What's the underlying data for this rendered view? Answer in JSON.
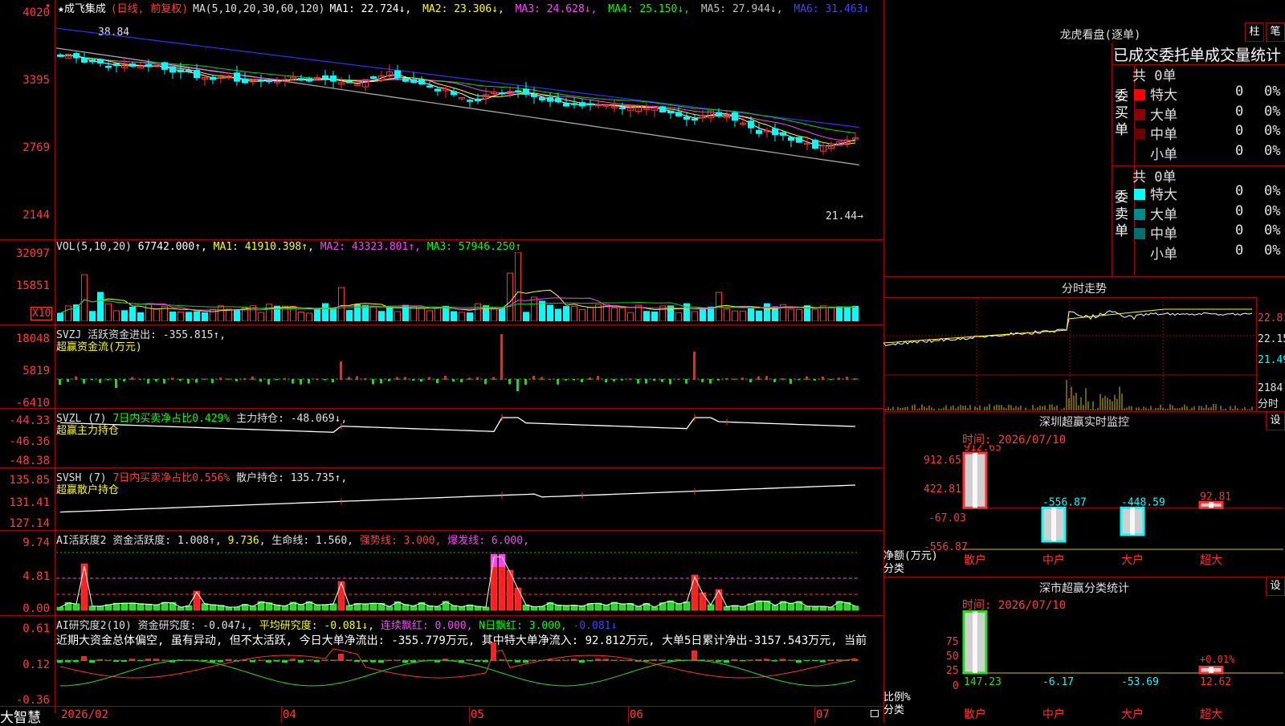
{
  "app": {
    "brand": "大智慧",
    "tab_glyph": "▾"
  },
  "main": {
    "stock_label": "★成飞集成",
    "mode": "(日线, 前复权)",
    "ma_title": "MA(5,10,20,30,60,120)",
    "ma_items": [
      {
        "text": "MA1: 22.724↓,",
        "color": "#ffffff"
      },
      {
        "text": "MA2: 23.306↓,",
        "color": "#ffff00"
      },
      {
        "text": "MA3: 24.628↓,",
        "color": "#ff40ff"
      },
      {
        "text": "MA4: 25.150↓,",
        "color": "#00ff00"
      },
      {
        "text": "MA5: 27.944↓,",
        "color": "#c0c0c0"
      },
      {
        "text": "MA6: 31.463↓",
        "color": "#4040ff"
      }
    ],
    "yticks": [
      "4020",
      "3395",
      "2769",
      "2144"
    ],
    "high_label": "38.84",
    "low_label": "21.44→"
  },
  "vol": {
    "title": "VOL(5,10,20)",
    "value": "67742.000↑,",
    "items": [
      {
        "text": "MA1: 41910.398↑,",
        "color": "#ffff00"
      },
      {
        "text": "MA2: 43323.801↑,",
        "color": "#ff40ff"
      },
      {
        "text": "MA3: 57946.250↑",
        "color": "#00ff00"
      }
    ],
    "yticks": [
      "32097",
      "15851"
    ],
    "unit": "X10"
  },
  "svzj": {
    "title": "SVZJ  活跃资金进出: -355.815↑,",
    "sub": "超赢资金流(万元)",
    "yticks": [
      "18048",
      "5819",
      "-6410"
    ]
  },
  "svzl": {
    "title": "SVZL (7) ",
    "mid": "7日内买卖净占比0.429%",
    "tail": "主力持仓: -48.069↓,",
    "sub": "超赢主力持仓",
    "yticks": [
      "-44.33",
      "-46.36",
      "-48.38"
    ]
  },
  "svsh": {
    "title": "SVSH (7) ",
    "mid": "7日内买卖净占比0.556%",
    "tail": "散户持仓: 135.735↑,",
    "sub": "超赢散户持仓",
    "yticks": [
      "135.85",
      "131.41",
      "127.14"
    ]
  },
  "ai1": {
    "items": [
      {
        "text": "AI活跃度2 资金活跃度: 1.008↑,",
        "color": "#e0e0e0"
      },
      {
        "text": "9.736,",
        "color": "#ffff00"
      },
      {
        "text": "生命线: 1.560,",
        "color": "#e0e0e0"
      },
      {
        "text": "强势线: 3.000,",
        "color": "#ff3b3b"
      },
      {
        "text": "爆发线: 6.000,",
        "color": "#ff40ff"
      }
    ],
    "yticks": [
      "9.74",
      "4.81",
      "0.00"
    ]
  },
  "ai2": {
    "items": [
      {
        "text": "AI研究度2(10) 资金研究度: -0.047↓,",
        "color": "#e0e0e0"
      },
      {
        "text": "平均研究度: -0.081↓,",
        "color": "#ffff00"
      },
      {
        "text": "连续飘红: 0.000,",
        "color": "#ff40ff"
      },
      {
        "text": "N日飘红: 3.000,",
        "color": "#00ff00"
      },
      {
        "text": "-0.081↓",
        "color": "#4040ff"
      }
    ],
    "comment": "近期大资金总体偏空, 虽有异动, 但不太活跃, 今日大单净流出: -355.779万元, 其中特大单净流入: 92.812万元, 大单5日累计净出-3157.543万元, 当前",
    "yticks": [
      "0.61",
      "0.12",
      "-0.36"
    ]
  },
  "xaxis": [
    "2026/02",
    "04",
    "05",
    "06",
    "07"
  ],
  "longhu": {
    "title": "龙虎看盘(逐单)",
    "btn1": "柱",
    "btn2": "笔",
    "subtitle": "已成交委托单成交量统计",
    "buy": {
      "side": "委买单",
      "total": "共 0单",
      "rows": [
        {
          "label": "特大",
          "n": "0",
          "pct": "0%",
          "color": "#ff0000"
        },
        {
          "label": "大单",
          "n": "0",
          "pct": "0%",
          "color": "#8b0000"
        },
        {
          "label": "中单",
          "n": "0",
          "pct": "0%",
          "color": "#6a0000"
        },
        {
          "label": "小单",
          "n": "0",
          "pct": "0%",
          "color": ""
        }
      ]
    },
    "sell": {
      "side": "委卖单",
      "total": "共 0单",
      "rows": [
        {
          "label": "特大",
          "n": "0",
          "pct": "0%",
          "color": "#00ffff"
        },
        {
          "label": "大单",
          "n": "0",
          "pct": "0%",
          "color": "#008b8b"
        },
        {
          "label": "中单",
          "n": "0",
          "pct": "0%",
          "color": "#007070"
        },
        {
          "label": "小单",
          "n": "0",
          "pct": "0%",
          "color": ""
        }
      ]
    }
  },
  "intraday": {
    "title": "分时走势",
    "yticks": [
      "22.81",
      "22.15",
      "21.49"
    ],
    "vol_label": "2184",
    "vol_unit": "分时"
  },
  "monitor": {
    "title": "深圳超赢实时监控",
    "btn": "设",
    "time": "时间: 2026/07/10",
    "yticks": [
      "912.65",
      "422.81",
      "-67.03",
      "-556.87"
    ],
    "ylabel": "净额(万元)",
    "xlabel": "分类",
    "cats": [
      "散户",
      "中户",
      "大户",
      "超大"
    ],
    "values": [
      "912.65",
      "-556.87",
      "-448.59",
      "92.81"
    ]
  },
  "classify": {
    "title": "深市超赢分类统计",
    "btn": "设",
    "time": "时间: 2026/07/10",
    "yticks": [
      "75",
      "50",
      "25",
      "0"
    ],
    "ylabel": "比例%",
    "xlabel": "分类",
    "cats": [
      "散户",
      "中户",
      "大户",
      "超大"
    ],
    "values": [
      "147.23",
      "-6.17",
      "-53.69",
      "12.62"
    ],
    "annot": "+0.01%"
  }
}
